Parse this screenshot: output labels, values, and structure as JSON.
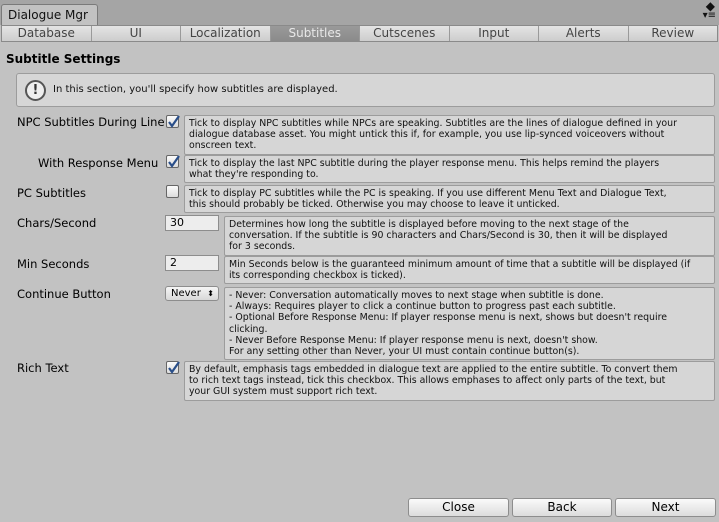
{
  "window": {
    "tab_title": "Dialogue Mgr"
  },
  "toolbar": {
    "tabs": [
      "Database",
      "UI",
      "Localization",
      "Subtitles",
      "Cutscenes",
      "Input",
      "Alerts",
      "Review"
    ],
    "active": "Subtitles"
  },
  "section": {
    "title": "Subtitle Settings",
    "info": "In this section, you'll specify how subtitles are displayed."
  },
  "settings": {
    "npc_subtitles": {
      "label": "NPC Subtitles During Line",
      "checked": true,
      "help": [
        "Tick to display NPC subtitles while NPCs are speaking. Subtitles are the lines of dialogue defined in your",
        "dialogue database asset. You might untick this if, for example, you use lip-synced voiceovers without",
        "onscreen text."
      ]
    },
    "with_response_menu": {
      "label": "With Response Menu",
      "checked": true,
      "help": [
        "Tick to display the last NPC subtitle during the player response menu. This helps remind the players",
        "what they're responding to."
      ]
    },
    "pc_subtitles": {
      "label": "PC Subtitles",
      "checked": false,
      "help": [
        "Tick to display PC subtitles while the PC is speaking. If you use different Menu Text and Dialogue Text,",
        "this should probably be ticked. Otherwise you may choose to leave it unticked."
      ]
    },
    "chars_per_second": {
      "label": "Chars/Second",
      "value": "30",
      "help": [
        "Determines how long the subtitle is displayed before moving to the next stage of the",
        "conversation. If the subtitle is 90 characters and Chars/Second is 30, then it will be displayed",
        "for 3 seconds."
      ]
    },
    "min_seconds": {
      "label": "Min Seconds",
      "value": "2",
      "help": [
        "Min Seconds below is the guaranteed minimum amount of time that a subtitle will be displayed (if",
        "its corresponding checkbox is ticked)."
      ]
    },
    "continue_button": {
      "label": "Continue Button",
      "value": "Never",
      "help": [
        "- Never: Conversation automatically moves to next stage when subtitle is done.",
        "- Always: Requires player to click a continue button to progress past each subtitle.",
        "- Optional Before Response Menu: If player response menu is next, shows but doesn't require",
        "clicking.",
        "- Never Before Response Menu: If player response menu is next, doesn't show.",
        "For any setting other than Never, your UI must contain continue button(s)."
      ]
    },
    "rich_text": {
      "label": "Rich Text",
      "checked": true,
      "help": [
        "By default, emphasis tags embedded in dialogue text are applied to the entire subtitle. To convert them",
        "to rich text tags instead, tick this checkbox. This allows emphases to affect only parts of the text, but",
        "your GUI system must support rich text."
      ]
    }
  },
  "buttons": {
    "close": "Close",
    "back": "Back",
    "next": "Next"
  }
}
